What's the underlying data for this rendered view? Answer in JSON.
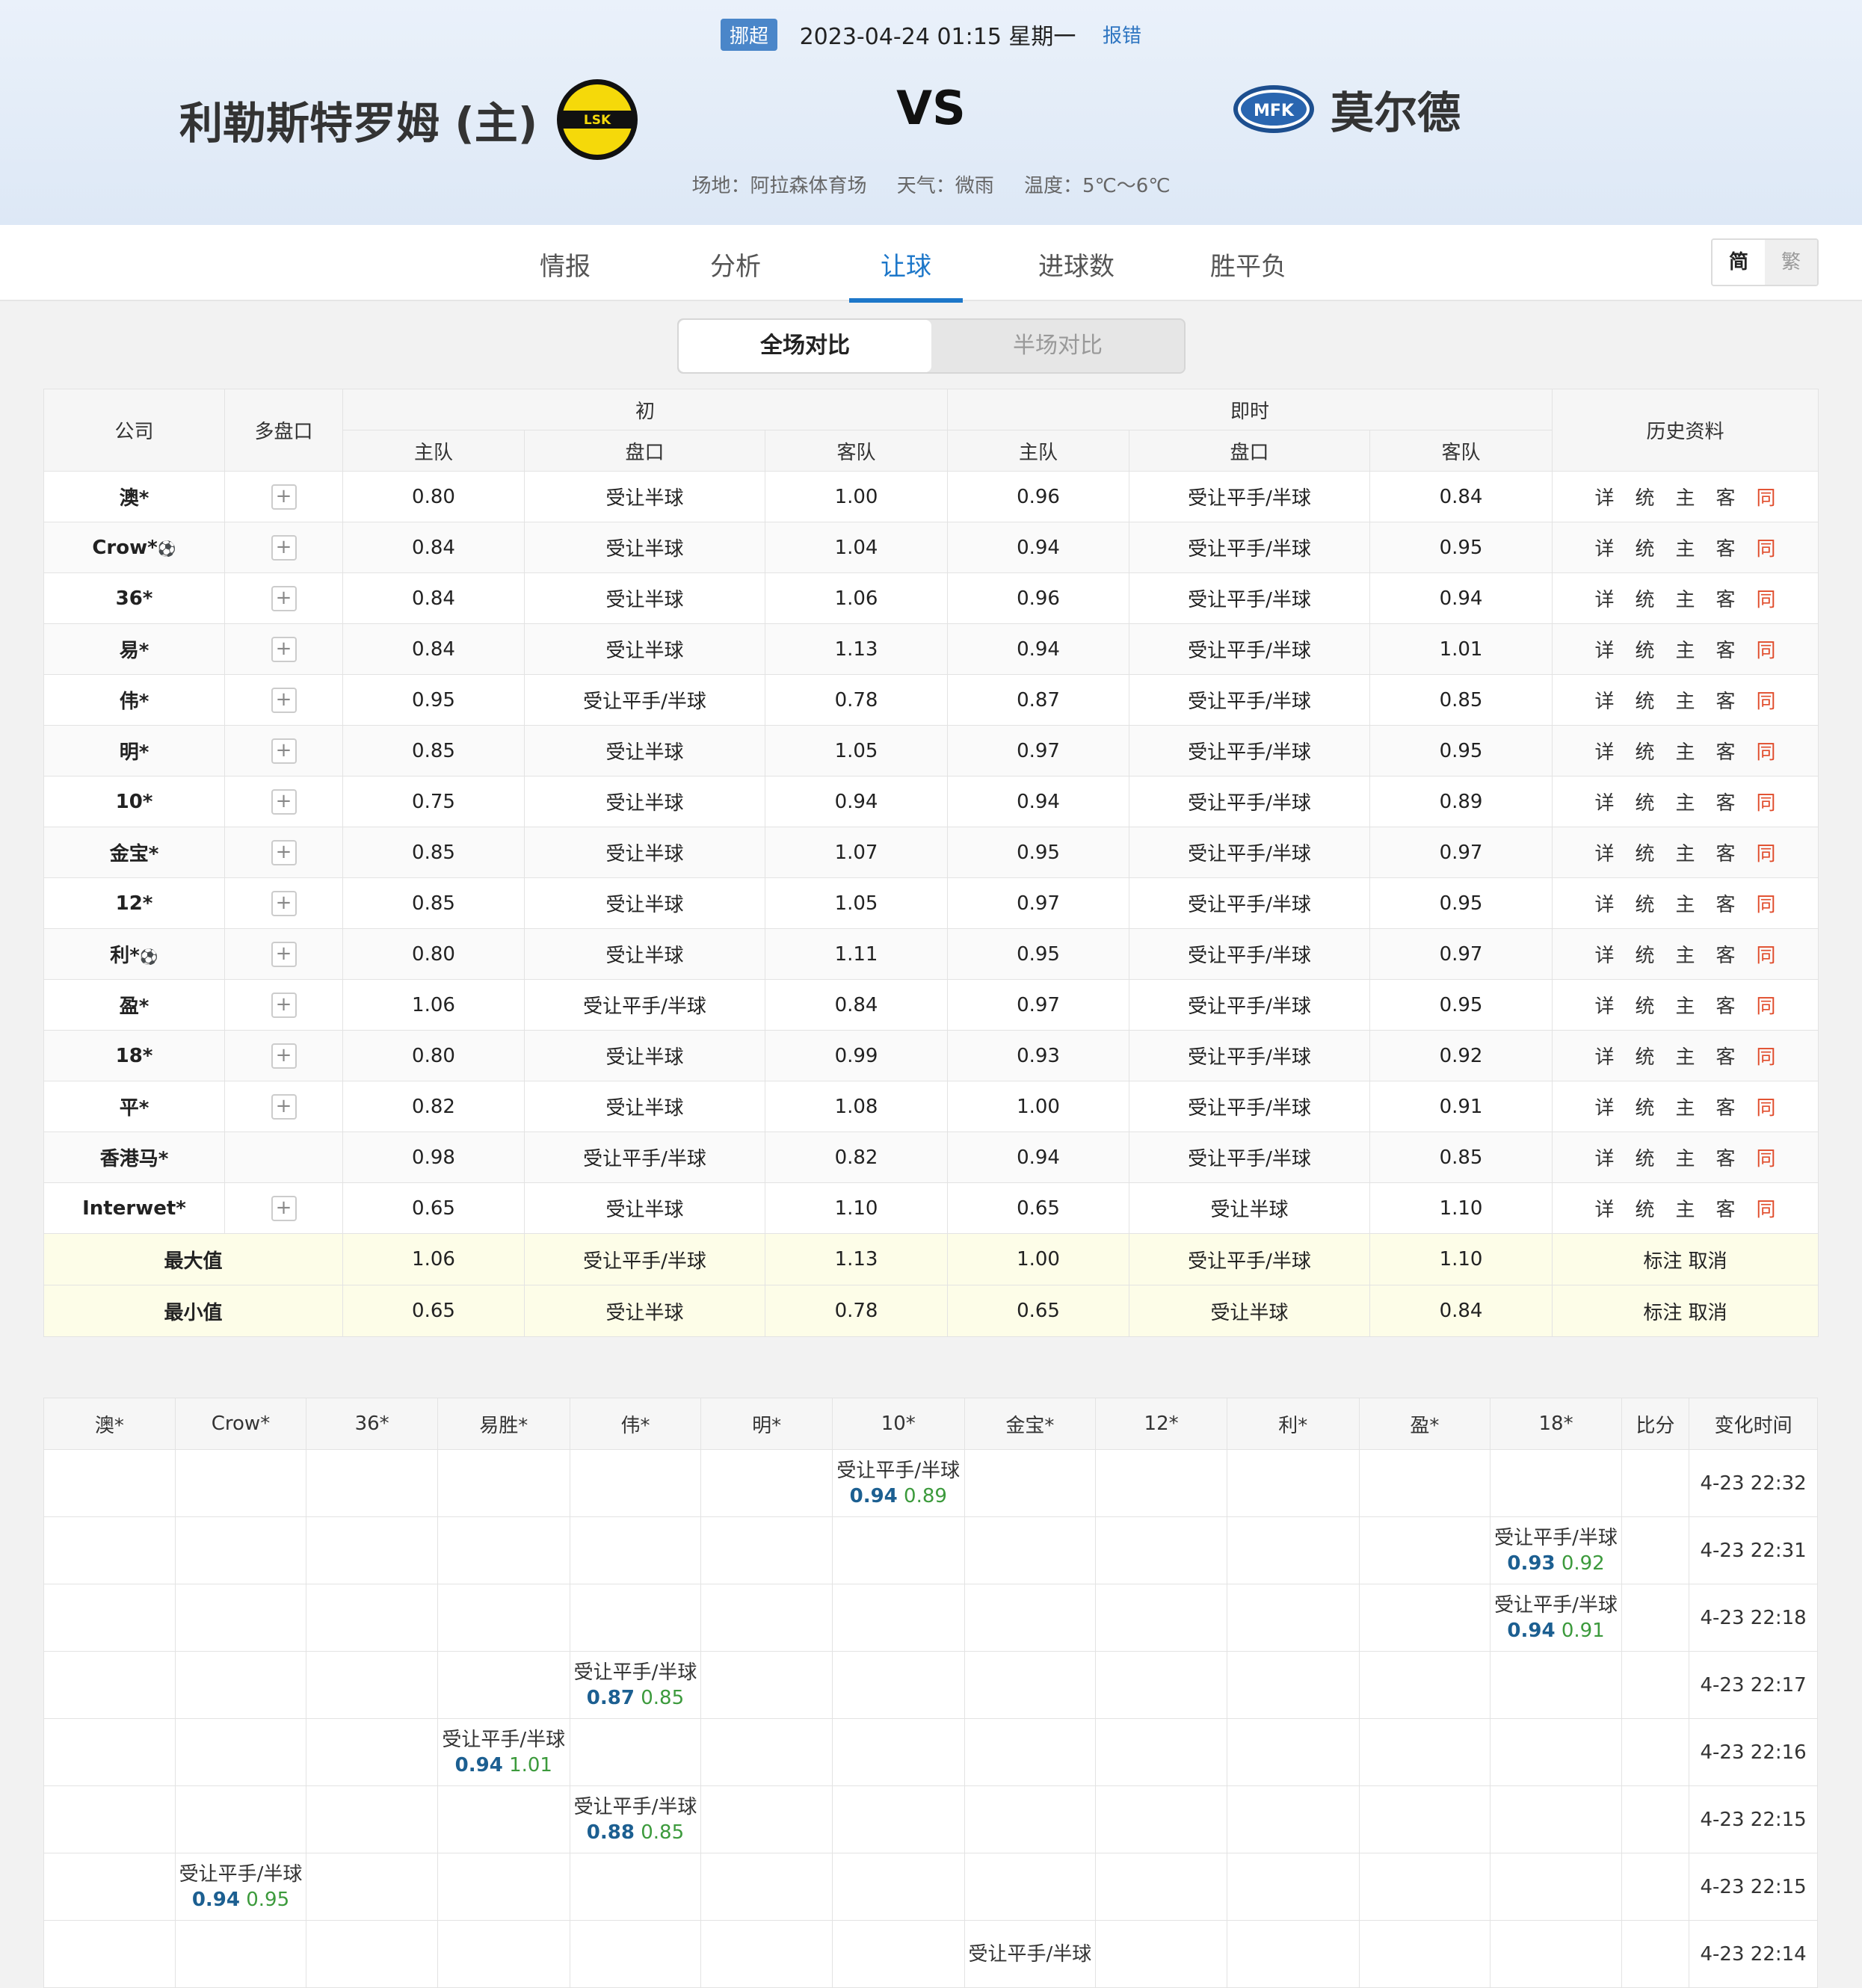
{
  "match": {
    "league": "挪超",
    "datetime": "2023-04-24 01:15 星期一",
    "report": "报错",
    "home_team": "利勒斯特罗姆 (主)",
    "away_team": "莫尔德",
    "vs": "VS",
    "home_logo_text": "LSK",
    "away_logo_text": "MFK",
    "venue": "场地：阿拉森体育场",
    "weather": "天气：微雨",
    "temperature": "温度：5℃～6℃"
  },
  "tabs": [
    "情报",
    "分析",
    "让球",
    "进球数",
    "胜平负"
  ],
  "active_tab": "让球",
  "lang": {
    "simplified": "简",
    "traditional": "繁"
  },
  "switch": {
    "full": "全场对比",
    "half": "半场对比"
  },
  "odds_table": {
    "headers": {
      "company": "公司",
      "multi": "多盘口",
      "initial": "初",
      "live": "即时",
      "history": "历史资料",
      "home": "主队",
      "line": "盘口",
      "away": "客队"
    },
    "history_links": [
      "详",
      "统",
      "主",
      "客",
      "同"
    ],
    "rows": [
      {
        "company": "澳*",
        "plus": true,
        "ih": "0.80",
        "il": "受让半球",
        "ia": "1.00",
        "lh": "0.96",
        "ll": "受让平手/半球",
        "la": "0.84"
      },
      {
        "company": "Crow*",
        "ball": true,
        "plus": true,
        "ih": "0.84",
        "il": "受让半球",
        "ia": "1.04",
        "lh": "0.94",
        "ll": "受让平手/半球",
        "la": "0.95"
      },
      {
        "company": "36*",
        "plus": true,
        "ih": "0.84",
        "il": "受让半球",
        "ia": "1.06",
        "lh": "0.96",
        "ll": "受让平手/半球",
        "la": "0.94"
      },
      {
        "company": "易*",
        "plus": true,
        "ih": "0.84",
        "il": "受让半球",
        "ia": "1.13",
        "lh": "0.94",
        "ll": "受让平手/半球",
        "la": "1.01"
      },
      {
        "company": "伟*",
        "plus": true,
        "ih": "0.95",
        "il": "受让平手/半球",
        "ia": "0.78",
        "lh": "0.87",
        "ll": "受让平手/半球",
        "la": "0.85"
      },
      {
        "company": "明*",
        "plus": true,
        "ih": "0.85",
        "il": "受让半球",
        "ia": "1.05",
        "lh": "0.97",
        "ll": "受让平手/半球",
        "la": "0.95"
      },
      {
        "company": "10*",
        "plus": true,
        "ih": "0.75",
        "il": "受让半球",
        "ia": "0.94",
        "lh": "0.94",
        "ll": "受让平手/半球",
        "la": "0.89"
      },
      {
        "company": "金宝*",
        "plus": true,
        "ih": "0.85",
        "il": "受让半球",
        "ia": "1.07",
        "lh": "0.95",
        "ll": "受让平手/半球",
        "la": "0.97"
      },
      {
        "company": "12*",
        "plus": true,
        "ih": "0.85",
        "il": "受让半球",
        "ia": "1.05",
        "lh": "0.97",
        "ll": "受让平手/半球",
        "la": "0.95"
      },
      {
        "company": "利*",
        "ball": true,
        "plus": true,
        "ih": "0.80",
        "il": "受让半球",
        "ia": "1.11",
        "lh": "0.95",
        "ll": "受让平手/半球",
        "la": "0.97"
      },
      {
        "company": "盈*",
        "plus": true,
        "ih": "1.06",
        "il": "受让平手/半球",
        "ia": "0.84",
        "lh": "0.97",
        "ll": "受让平手/半球",
        "la": "0.95"
      },
      {
        "company": "18*",
        "plus": true,
        "ih": "0.80",
        "il": "受让半球",
        "ia": "0.99",
        "lh": "0.93",
        "ll": "受让平手/半球",
        "la": "0.92"
      },
      {
        "company": "平*",
        "plus": true,
        "ih": "0.82",
        "il": "受让半球",
        "ia": "1.08",
        "lh": "1.00",
        "ll": "受让平手/半球",
        "la": "0.91"
      },
      {
        "company": "香港马*",
        "plus": false,
        "ih": "0.98",
        "il": "受让平手/半球",
        "ia": "0.82",
        "lh": "0.94",
        "ll": "受让平手/半球",
        "la": "0.85"
      },
      {
        "company": "Interwet*",
        "plus": true,
        "ih": "0.65",
        "il": "受让半球",
        "ia": "1.10",
        "lh": "0.65",
        "ll": "受让半球",
        "la": "1.10"
      }
    ],
    "max_row": {
      "label": "最大值",
      "ih": "1.06",
      "il": "受让平手/半球",
      "ia": "1.13",
      "lh": "1.00",
      "ll": "受让平手/半球",
      "la": "1.10",
      "action": "标注 取消"
    },
    "min_row": {
      "label": "最小值",
      "ih": "0.65",
      "il": "受让半球",
      "ia": "0.78",
      "lh": "0.65",
      "ll": "受让半球",
      "la": "0.84",
      "action": "标注 取消"
    }
  },
  "change_table": {
    "headers": [
      "澳*",
      "Crow*",
      "36*",
      "易胜*",
      "伟*",
      "明*",
      "10*",
      "金宝*",
      "12*",
      "利*",
      "盈*",
      "18*",
      "比分",
      "变化时间"
    ],
    "rows": [
      {
        "col": 6,
        "line": "受让平手/半球",
        "home": "0.94",
        "away": "0.89",
        "time": "4-23 22:32"
      },
      {
        "col": 11,
        "line": "受让平手/半球",
        "home": "0.93",
        "away": "0.92",
        "time": "4-23 22:31"
      },
      {
        "col": 11,
        "line": "受让平手/半球",
        "home": "0.94",
        "away": "0.91",
        "time": "4-23 22:18"
      },
      {
        "col": 4,
        "line": "受让平手/半球",
        "home": "0.87",
        "away": "0.85",
        "time": "4-23 22:17"
      },
      {
        "col": 3,
        "line": "受让平手/半球",
        "home": "0.94",
        "away": "1.01",
        "time": "4-23 22:16"
      },
      {
        "col": 4,
        "line": "受让平手/半球",
        "home": "0.88",
        "away": "0.85",
        "time": "4-23 22:15"
      },
      {
        "col": 1,
        "line": "受让平手/半球",
        "home": "0.94",
        "away": "0.95",
        "time": "4-23 22:15"
      },
      {
        "col": 7,
        "line": "受让平手/半球",
        "home": "",
        "away": "",
        "time": "4-23 22:14"
      }
    ]
  },
  "colors": {
    "accent": "#1d77c9",
    "league_badge": "#4a86c9",
    "history_same": "#e04b2a",
    "odds_home": "#1c5f91",
    "odds_away": "#3c9a3c",
    "summary_bg": "#fdfde8"
  }
}
